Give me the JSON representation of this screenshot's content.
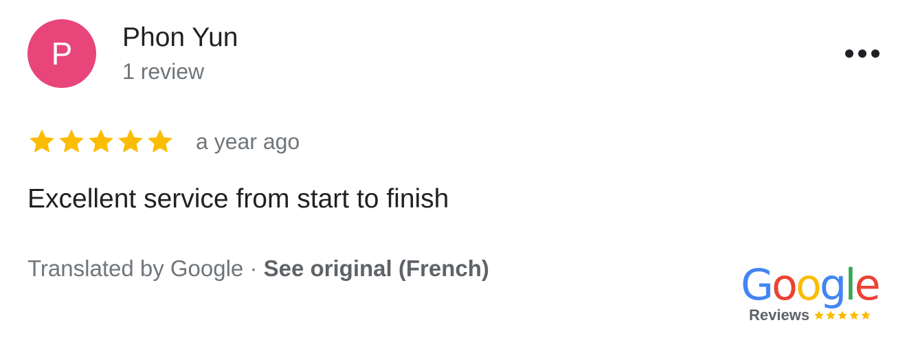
{
  "reviewer": {
    "avatar_initial": "P",
    "avatar_color": "#e8457a",
    "name": "Phon Yun",
    "review_count": "1 review"
  },
  "menu": {
    "icon": "more-horizontal-icon"
  },
  "review": {
    "rating": 5,
    "rating_max": 5,
    "star_color": "#fbbc04",
    "date": "a year ago",
    "text": "Excellent service from start to finish"
  },
  "translation": {
    "prefix": "Translated by Google · ",
    "link": "See original (French)"
  },
  "badge": {
    "letters": [
      "G",
      "o",
      "o",
      "g",
      "l",
      "e"
    ],
    "letter_colors": [
      "#4285f4",
      "#ea4335",
      "#fbbc05",
      "#4285f4",
      "#34a853",
      "#ea4335"
    ],
    "label": "Reviews",
    "star_count": 5,
    "star_color": "#fbbc04"
  }
}
